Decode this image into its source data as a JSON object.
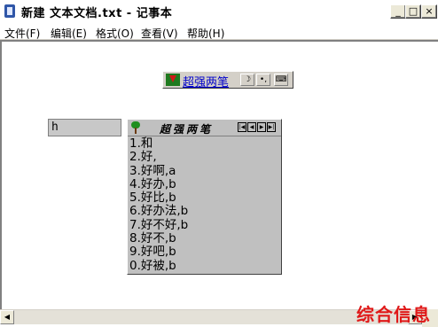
{
  "window": {
    "title": "新建 文本文档.txt - 记事本",
    "controls": [
      "_",
      "□",
      "×"
    ]
  },
  "menu": {
    "items": [
      "文件(F)",
      "编辑(E)",
      "格式(O)",
      "查看(V)",
      "帮助(H)"
    ]
  },
  "ime": {
    "name": "超强两笔",
    "toolbar": [
      "☽",
      "•,",
      "⌨"
    ]
  },
  "composition": {
    "text": "h"
  },
  "candidates": {
    "title": "超强两笔",
    "nav": [
      "|◀",
      "◀",
      "▶",
      "▶|"
    ],
    "items": [
      "1.和",
      "2.好,",
      "3.好啊,a",
      "4.好办,b",
      "5.好比,b",
      "6.好办法,b",
      "7.好不好,b",
      "8.好不,b",
      "9.好吧,b",
      "0.好被,b"
    ]
  },
  "scrollbar": {
    "left_arrow": "◀",
    "right_arrow": "▶"
  },
  "watermark": {
    "text": "综合信息"
  }
}
